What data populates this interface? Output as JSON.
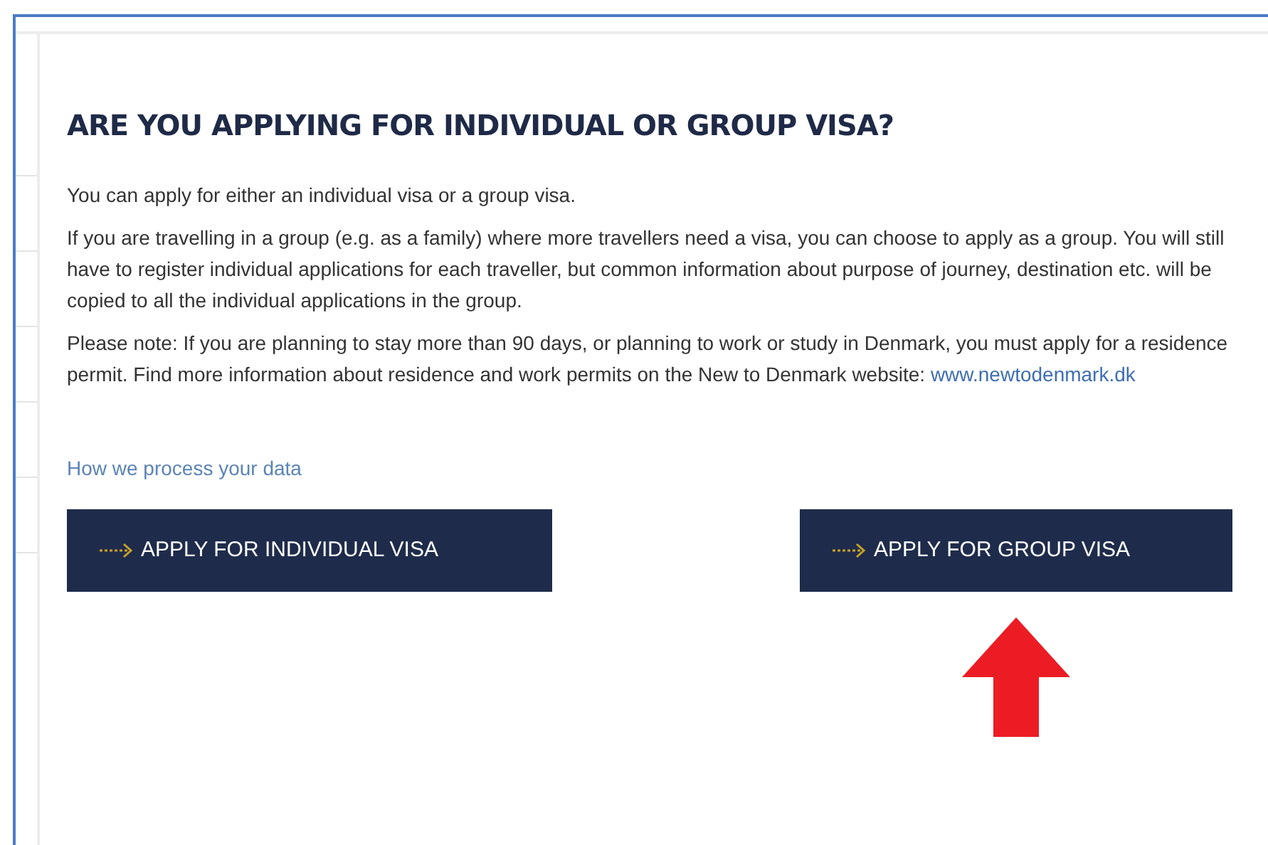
{
  "heading": "ARE YOU APPLYING FOR INDIVIDUAL OR GROUP VISA?",
  "paragraphs": [
    {
      "text": "You can apply for either an individual visa or a group visa."
    },
    {
      "text": "If you are travelling in a group (e.g. as a family) where more travellers need a visa, you can choose to apply as a group. You will still have to register individual applications for each traveller, but common information about purpose of journey, destination etc. will be copied to all the individual applications in the group."
    },
    {
      "text": "Please note: If you are planning to stay more than 90 days, or planning to work or study in Denmark, you must apply for a residence permit. Find more information about residence and work permits on the New to Denmark website:",
      "link": "www.newtodenmark.dk"
    }
  ],
  "privacy_link": "How we process your data",
  "buttons": [
    {
      "label": "APPLY FOR INDIVIDUAL VISA",
      "highlighted": false
    },
    {
      "label": "APPLY FOR GROUP VISA",
      "highlighted": true
    }
  ]
}
